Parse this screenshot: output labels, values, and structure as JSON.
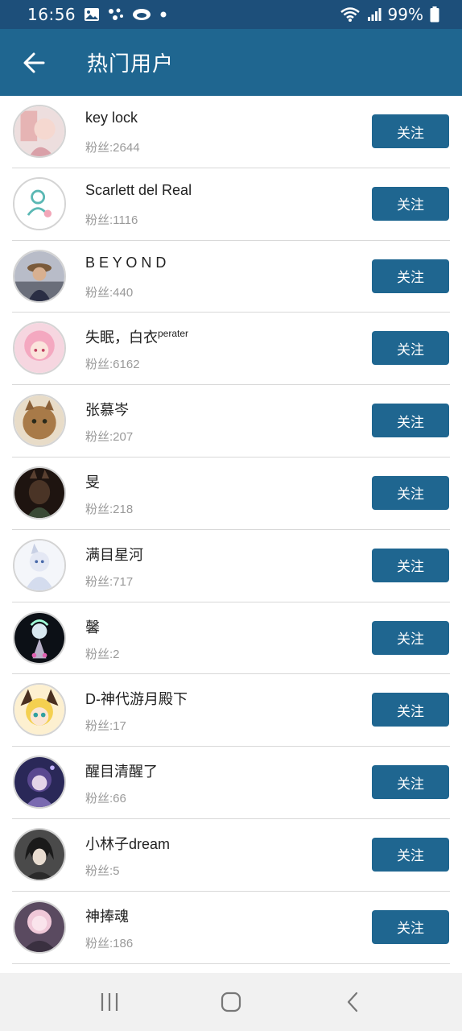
{
  "status_bar": {
    "time": "16:56",
    "battery": "99%",
    "icons": [
      "gallery-icon",
      "dots-icon",
      "cloud-icon",
      "notification-dot-icon",
      "wifi-icon",
      "signal-icon",
      "battery-icon"
    ]
  },
  "app_bar": {
    "title": "热门用户",
    "back_icon": "back-arrow-icon"
  },
  "follow_label": "关注",
  "users": [
    {
      "name": "key lock",
      "fans": "粉丝:2644",
      "avatar_color": "#e8c8c8"
    },
    {
      "name": "Scarlett del Real",
      "fans": "粉丝:1116",
      "avatar_color": "#ffffff"
    },
    {
      "name": "B E Y O N D",
      "fans": "粉丝:440",
      "avatar_color": "#8a8a9a"
    },
    {
      "name": "失眠，白衣",
      "name_sup": "perater",
      "fans": "粉丝:6162",
      "avatar_color": "#f5b8c8"
    },
    {
      "name": "张慕岑",
      "fans": "粉丝:207",
      "avatar_color": "#a8845a"
    },
    {
      "name": "旻",
      "fans": "粉丝:218",
      "avatar_color": "#3a2a22"
    },
    {
      "name": "满目星河",
      "fans": "粉丝:717",
      "avatar_color": "#e0e4ee"
    },
    {
      "name": "馨",
      "fans": "粉丝:2",
      "avatar_color": "#101820"
    },
    {
      "name": "D-神代游月殿下",
      "fans": "粉丝:17",
      "avatar_color": "#f2d060"
    },
    {
      "name": "醒目清醒了",
      "fans": "粉丝:66",
      "avatar_color": "#3c3870"
    },
    {
      "name": "小林子dream",
      "fans": "粉丝:5",
      "avatar_color": "#2a2a2a"
    },
    {
      "name": "神捧魂",
      "fans": "粉丝:186",
      "avatar_color": "#6a5a70"
    }
  ],
  "nav_bar": {
    "icons": [
      "recent-apps-icon",
      "home-icon",
      "nav-back-icon"
    ]
  }
}
